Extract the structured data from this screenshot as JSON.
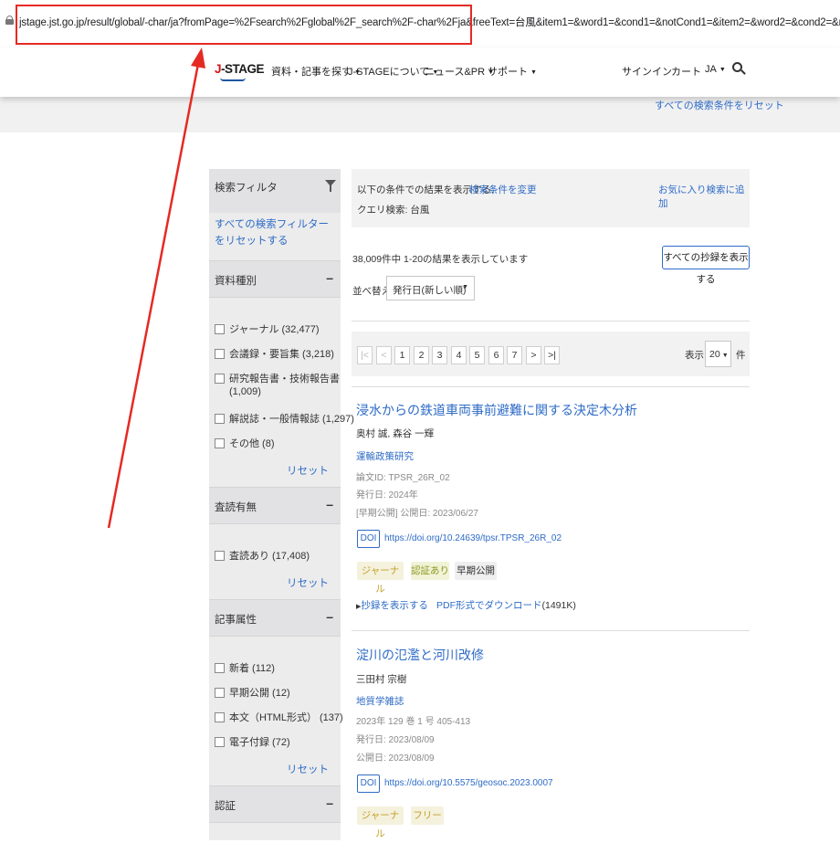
{
  "browser": {
    "url": "jstage.jst.go.jp/result/global/-char/ja?fromPage=%2Fsearch%2Fglobal%2F_search%2F-char%2Fja&freeText=台風&item1=&word1=&cond1=&notCond1=&item2=&word2=&cond2=&notCond2=&item3=&word3..."
  },
  "header": {
    "logo": "J-STAGE",
    "nav": [
      "資料・記事を探す",
      "J-STAGEについて",
      "ニュース&PR",
      "サポート"
    ],
    "signin": "サインイン",
    "cart": "カート",
    "lang": "JA",
    "reset_all": "すべての検索条件をリセット"
  },
  "sidebar": {
    "title": "検索フィルタ",
    "reset_all_filters": "すべての検索フィルターをリセットする",
    "sections": [
      {
        "title": "資料種別",
        "items": [
          "ジャーナル (32,477)",
          "会議録・要旨集 (3,218)",
          "研究報告書・技術報告書",
          "(1,009)",
          "解説誌・一般情報誌 (1,297)",
          "その他 (8)"
        ],
        "reset": "リセット"
      },
      {
        "title": "査読有無",
        "items": [
          "査読あり (17,408)"
        ],
        "reset": "リセット"
      },
      {
        "title": "記事属性",
        "items": [
          "新着 (112)",
          "早期公開 (12)",
          "本文（HTML形式） (137)",
          "電子付録 (72)"
        ],
        "reset": "リセット"
      },
      {
        "title": "認証"
      }
    ]
  },
  "main": {
    "conditions_label": "以下の条件での結果を表示する:",
    "change_conditions": "検索条件を変更",
    "save_search": "お気に入り検索に追加",
    "query": "クエリ検索: 台風",
    "results_count": "38,009件中 1-20の結果を表示しています",
    "show_abstracts": "すべての抄録を表示する",
    "sort_label": "並べ替え",
    "sort_value": "発行日(新しい順)",
    "pager": [
      "|<",
      "<",
      "1",
      "2",
      "3",
      "4",
      "5",
      "6",
      "7",
      ">",
      ">|"
    ],
    "perpage_label": "表示",
    "perpage_value": "20",
    "perpage_unit": "件",
    "results": [
      {
        "title": "浸水からの鉄道車両事前避難に関する決定木分析",
        "authors": "奥村 誠, 森谷 一輝",
        "journal": "運輸政策研究",
        "meta": [
          "論文ID: TPSR_26R_02",
          "発行日: 2024年",
          "[早期公開] 公開日: 2023/06/27"
        ],
        "doi_label": "DOI",
        "doi": "https://doi.org/10.24639/tpsr.TPSR_26R_02",
        "tags": [
          "ジャーナル",
          "認証あり",
          "早期公開"
        ],
        "abstract_toggle": "抄録を表示する",
        "pdf": "PDF形式でダウンロード",
        "pdf_size": "(1491K)"
      },
      {
        "title": "淀川の氾濫と河川改修",
        "authors": "三田村 宗樹",
        "journal": "地質学雑誌",
        "meta": [
          "2023年 129 巻 1 号 405-413",
          "発行日: 2023/08/09",
          "公開日: 2023/08/09"
        ],
        "doi_label": "DOI",
        "doi": "https://doi.org/10.5575/geosoc.2023.0007",
        "tags": [
          "ジャーナル",
          "フリー"
        ]
      }
    ]
  },
  "colors": {
    "link": "#2e6bc6",
    "annotation_red": "#e52a24"
  }
}
